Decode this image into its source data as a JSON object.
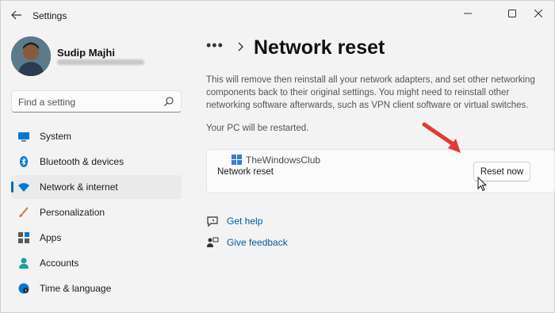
{
  "window": {
    "title": "Settings"
  },
  "user": {
    "name": "Sudip Majhi"
  },
  "search": {
    "placeholder": "Find a setting"
  },
  "sidebar": {
    "items": [
      {
        "label": "System",
        "icon": "system-icon",
        "selected": false
      },
      {
        "label": "Bluetooth & devices",
        "icon": "bluetooth-icon",
        "selected": false
      },
      {
        "label": "Network & internet",
        "icon": "wifi-icon",
        "selected": true
      },
      {
        "label": "Personalization",
        "icon": "brush-icon",
        "selected": false
      },
      {
        "label": "Apps",
        "icon": "apps-icon",
        "selected": false
      },
      {
        "label": "Accounts",
        "icon": "person-icon",
        "selected": false
      },
      {
        "label": "Time & language",
        "icon": "globe-clock-icon",
        "selected": false
      }
    ]
  },
  "main": {
    "breadcrumb_more": "•••",
    "title": "Network reset",
    "description": "This will remove then reinstall all your network adapters, and set other networking components back to their original settings. You might need to reinstall other networking software afterwards, such as VPN client software or virtual switches.",
    "restart_note": "Your PC will be restarted.",
    "card_label": "Network reset",
    "reset_button": "Reset now",
    "watermark": "TheWindowsClub",
    "links": {
      "help": "Get help",
      "feedback": "Give feedback"
    }
  },
  "colors": {
    "accent": "#0067c0",
    "link": "#005a9e",
    "annotation_arrow": "#e53935"
  }
}
